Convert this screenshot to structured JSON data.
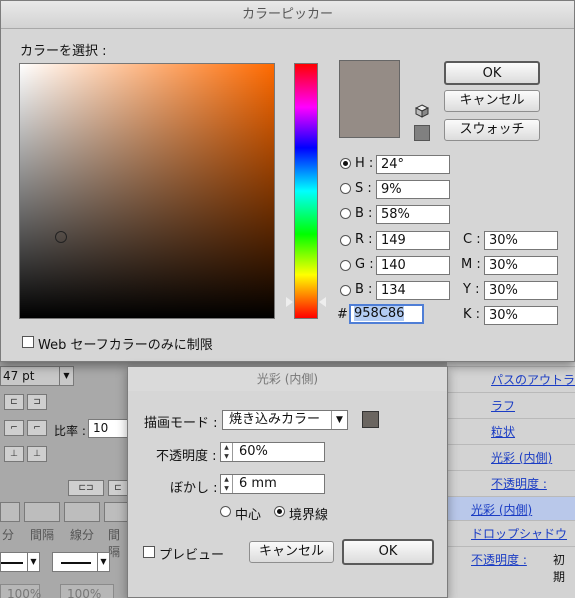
{
  "picker": {
    "title": "カラーピッカー",
    "select_label": "カラーを選択 :",
    "buttons": {
      "ok": "OK",
      "cancel": "キャンセル",
      "swatches": "スウォッチ"
    },
    "hsb": [
      {
        "label": "H :",
        "value": "24°",
        "selected": true
      },
      {
        "label": "S :",
        "value": "9%",
        "selected": false
      },
      {
        "label": "B :",
        "value": "58%",
        "selected": false
      }
    ],
    "rgb": [
      {
        "label": "R :",
        "value": "149"
      },
      {
        "label": "G :",
        "value": "140"
      },
      {
        "label": "B :",
        "value": "134"
      }
    ],
    "cmyk": [
      {
        "label": "C :",
        "value": "30%"
      },
      {
        "label": "M :",
        "value": "30%"
      },
      {
        "label": "Y :",
        "value": "30%"
      },
      {
        "label": "K :",
        "value": "30%"
      }
    ],
    "hex_symbol": "#",
    "hex_value": "958C86",
    "web_only_label": "Web セーフカラーのみに制限",
    "web_only_checked": false,
    "current_color": "#958c86"
  },
  "glow": {
    "title": "光彩 (内側)",
    "blend_mode_label": "描画モード :",
    "blend_mode_value": "焼き込みカラー",
    "opacity_label": "不透明度 :",
    "opacity_value": "60%",
    "blur_label": "ぼかし :",
    "blur_value": "6 mm",
    "position_options": [
      "中心",
      "境界線"
    ],
    "position_selected": "境界線",
    "preview_label": "プレビュー",
    "preview_checked": false,
    "cancel_label": "キャンセル",
    "ok_label": "OK",
    "glow_color": "#6a6560"
  },
  "background": {
    "stroke_weight": "47 pt",
    "ratio_label": "比率 :",
    "ratio_value": "10",
    "dash_labels": [
      "分",
      "間隔",
      "線分",
      "間隔"
    ],
    "percent_a": "100%",
    "percent_b": "100%",
    "appearance_items": [
      {
        "label": "パスのアウトラ",
        "selected": false
      },
      {
        "label": "ラフ",
        "selected": false
      },
      {
        "label": "粒状",
        "selected": false
      },
      {
        "label": "光彩 (内側)",
        "selected": false
      },
      {
        "label": "不透明度 :",
        "selected": false
      },
      {
        "label": "光彩 (内側)",
        "selected": true
      },
      {
        "label": "ドロップシャドウ",
        "selected": false
      },
      {
        "label": "不透明度 :",
        "selected": false
      }
    ],
    "default_label": "初期"
  }
}
